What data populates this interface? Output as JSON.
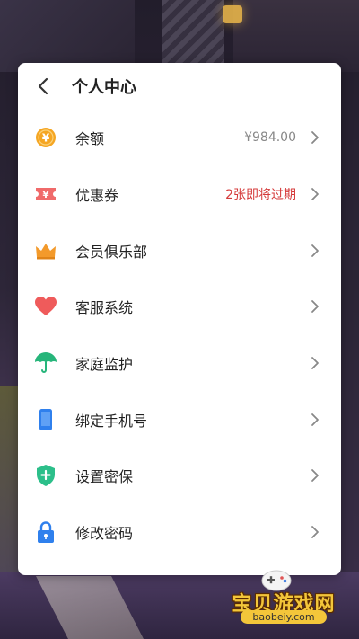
{
  "header": {
    "title": "个人中心"
  },
  "menu": [
    {
      "label": "余额",
      "value": "¥984.00",
      "value_style": "normal",
      "icon": "coin-icon"
    },
    {
      "label": "优惠券",
      "value": "2张即将过期",
      "value_style": "warn",
      "icon": "coupon-icon"
    },
    {
      "label": "会员俱乐部",
      "value": "",
      "icon": "crown-icon"
    },
    {
      "label": "客服系统",
      "value": "",
      "icon": "heart-icon"
    },
    {
      "label": "家庭监护",
      "value": "",
      "icon": "umbrella-icon"
    },
    {
      "label": "绑定手机号",
      "value": "",
      "icon": "phone-icon"
    },
    {
      "label": "设置密保",
      "value": "",
      "icon": "shield-icon"
    },
    {
      "label": "修改密码",
      "value": "",
      "icon": "lock-icon"
    }
  ],
  "watermark": {
    "name": "宝贝游戏网",
    "url": "baobeiy.com"
  },
  "colors": {
    "coin": "#f5a623",
    "coupon": "#f06a6a",
    "crown": "#f39a2b",
    "heart": "#ef5b5b",
    "umbrella": "#26b57a",
    "phone": "#2f80ed",
    "shield": "#2cbf8a",
    "lock": "#2f80ed",
    "warn": "#d53a3a"
  }
}
